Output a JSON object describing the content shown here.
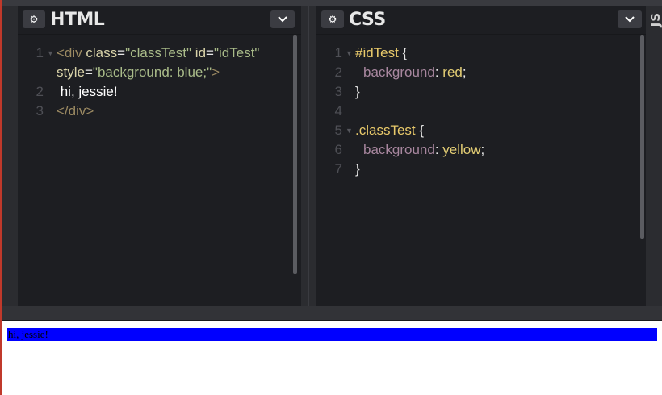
{
  "html_panel": {
    "title": "HTML",
    "settings_icon": "gear-icon",
    "collapse_icon": "chevron-down-icon",
    "line_numbers": [
      "1",
      "2",
      "3"
    ],
    "code": {
      "l1_open": "<div",
      "l1_attr1": " class",
      "l1_eq1": "=",
      "l1_val1": "\"classTest\"",
      "l1_attr2": " id",
      "l1_eq2": "=",
      "l1_val2": "\"idTest\"",
      "l1b_attr3": "style",
      "l1b_eq3": "=",
      "l1b_val3": "\"background: blue;\"",
      "l1b_close": ">",
      "l2_text": " hi, jessie!",
      "l3_close": "</div>"
    }
  },
  "css_panel": {
    "title": "CSS",
    "settings_icon": "gear-icon",
    "collapse_icon": "chevron-down-icon",
    "line_numbers": [
      "1",
      "2",
      "3",
      "4",
      "5",
      "6",
      "7"
    ],
    "code": {
      "r1_selector": "#idTest",
      "r1_brace": " {",
      "r1_prop": "background",
      "r1_colon": ": ",
      "r1_value": "red",
      "r1_semi": ";",
      "r1_end": "}",
      "r2_selector": ".classTest",
      "r2_brace": " {",
      "r2_prop": "background",
      "r2_colon": ": ",
      "r2_value": "yellow",
      "r2_semi": ";",
      "r2_end": "}"
    }
  },
  "js_panel": {
    "label": "JS"
  },
  "preview": {
    "text": "hi, jessie!",
    "background": "#0000ff"
  },
  "colors": {
    "editor_bg": "#1d1e22",
    "chrome_bg": "#2b2c30",
    "preview_box": "#0000ff"
  }
}
